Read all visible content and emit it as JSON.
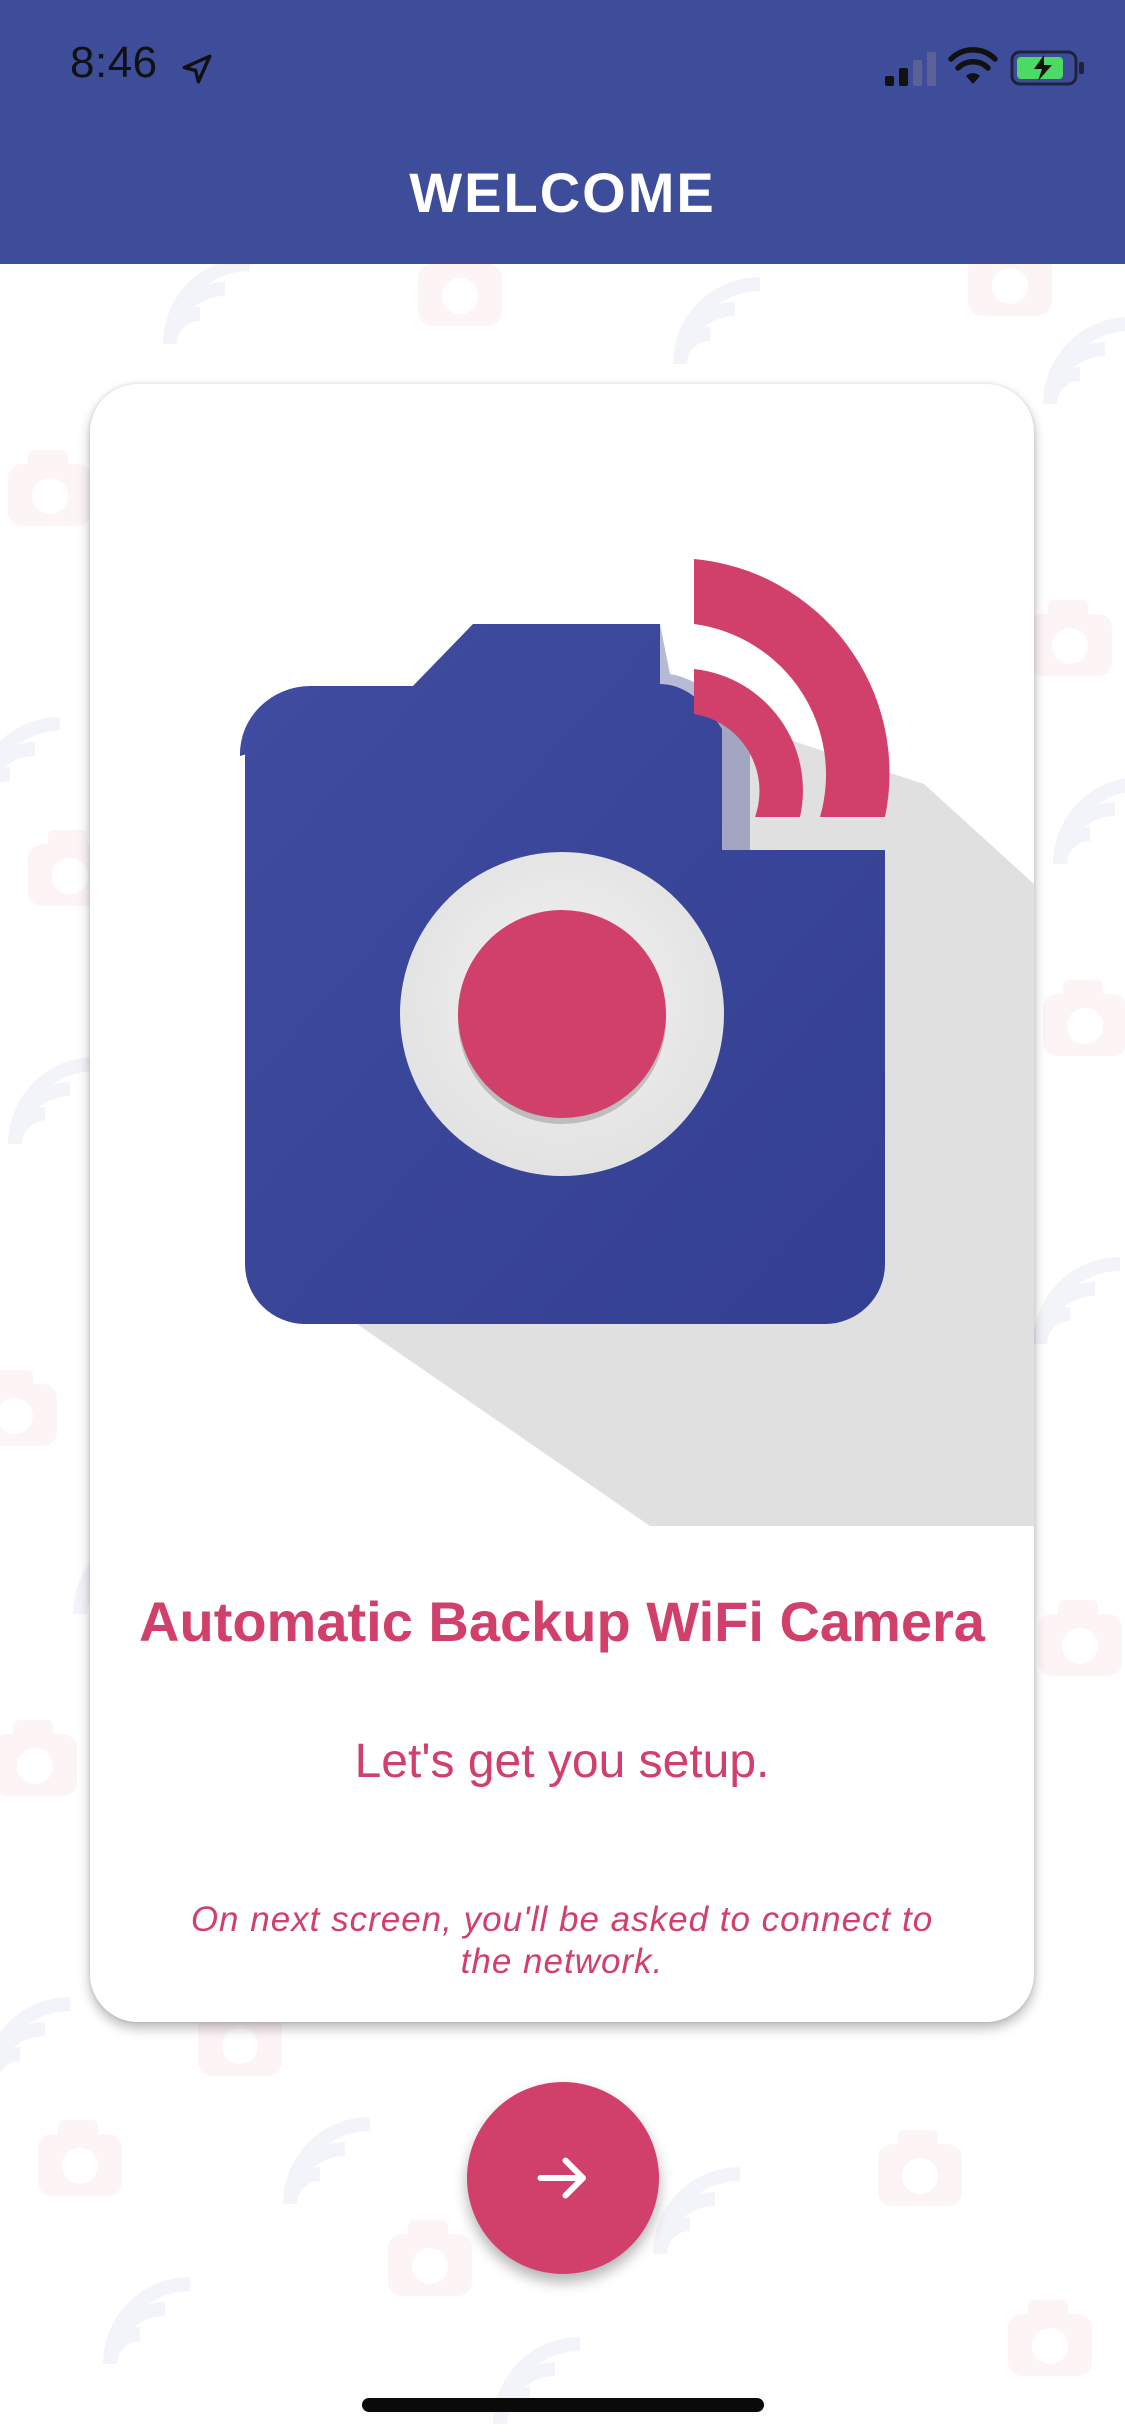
{
  "status_bar": {
    "time": "8:46",
    "icons": [
      "location-arrow-icon",
      "cellular-signal-icon",
      "wifi-icon",
      "battery-charging-icon"
    ]
  },
  "header": {
    "title": "WELCOME"
  },
  "card": {
    "image_icon": "wifi-camera-logo",
    "title": "Automatic Backup WiFi Camera",
    "subtitle": "Let's get you setup.",
    "note": "On next screen, you'll be asked to connect to the network."
  },
  "next_button": {
    "icon": "arrow-right-icon"
  },
  "colors": {
    "header_bg": "#3e4d9a",
    "accent": "#d1406b",
    "camera_body": "#3a479a",
    "shadow": "#e0e0e0"
  }
}
